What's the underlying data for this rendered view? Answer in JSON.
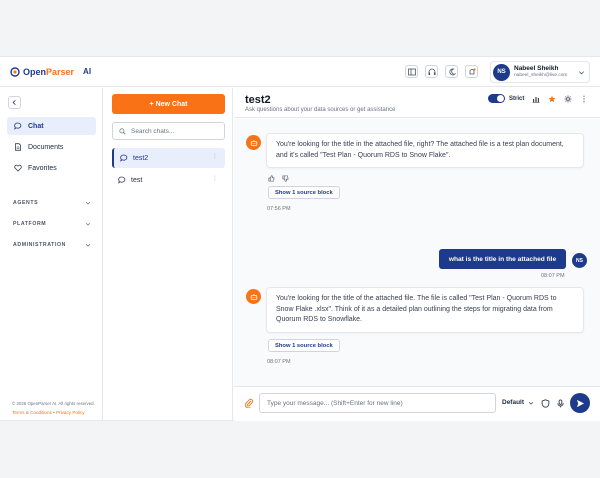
{
  "brand": {
    "name_part1": "Open",
    "name_part2": "Parser",
    "suffix": "AI"
  },
  "user": {
    "initials": "NS",
    "name": "Nabeel Sheikh",
    "email": "nabeel_sheikh@live.com"
  },
  "nav": {
    "items": [
      {
        "label": "Chat",
        "icon": "chat-icon",
        "active": true
      },
      {
        "label": "Documents",
        "icon": "document-icon",
        "active": false
      },
      {
        "label": "Favorites",
        "icon": "heart-icon",
        "active": false
      }
    ],
    "sections": [
      {
        "label": "AGENTS"
      },
      {
        "label": "PLATFORM"
      },
      {
        "label": "ADMINISTRATION"
      }
    ],
    "footer": {
      "copyright": "© 2025 OpenParser AI. All rights reserved.",
      "terms": "Terms & Conditions",
      "separator": "•",
      "privacy": "Privacy Policy"
    }
  },
  "chats": {
    "new_chat_label": "+ New Chat",
    "search_placeholder": "Search chats...",
    "list": [
      {
        "name": "test2",
        "active": true
      },
      {
        "name": "test",
        "active": false
      }
    ]
  },
  "main": {
    "title": "test2",
    "subtitle": "Ask questions about your data sources or get assistance",
    "strict_label": "Strict",
    "strict_on": true,
    "accent_color": "#f97316",
    "primary_color": "#1e3a8a"
  },
  "messages": [
    {
      "role": "assistant",
      "text": "You're looking for the title in the attached file, right? The attached file is a test plan document, and it's called \"Test Plan - Quorum RDS to Snow Flake\".",
      "source_button": "Show 1 source block",
      "time": "07:56 PM"
    },
    {
      "role": "user",
      "text": "what is the title in the attached file",
      "initials": "NS",
      "time": "08:07 PM"
    },
    {
      "role": "assistant",
      "text": "You're looking for the title of the attached file. The file is called \"Test Plan - Quorum RDS to Snow Flake .xlsx\". Think of it as a detailed plan outlining the steps for migrating data from Quorum RDS to Snowflake.",
      "source_button": "Show 1 source block",
      "time": "08:07 PM"
    }
  ],
  "composer": {
    "placeholder": "Type your message... (Shift+Enter for new line)",
    "model": "Default"
  }
}
